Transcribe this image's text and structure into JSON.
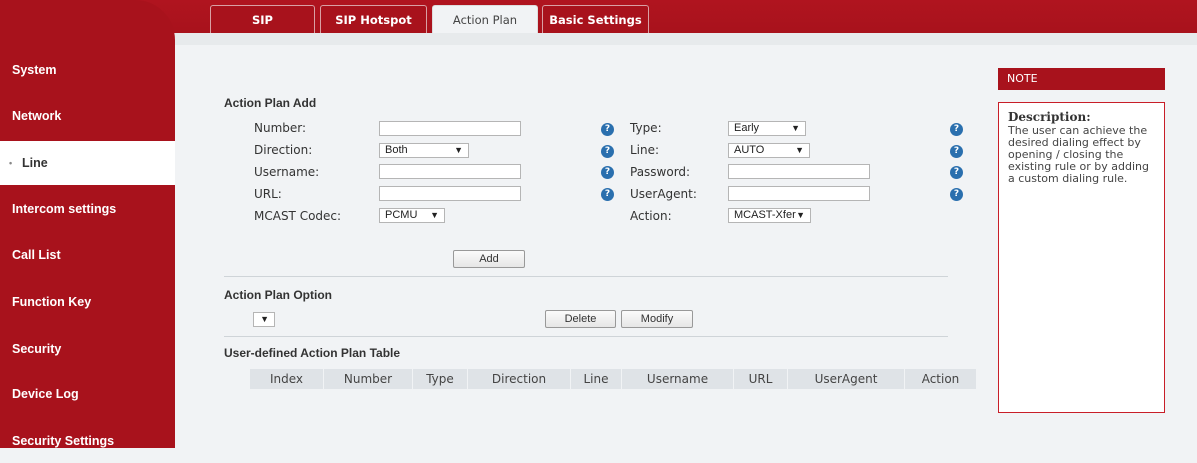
{
  "tabs": [
    {
      "label": "SIP",
      "active": false
    },
    {
      "label": "SIP Hotspot",
      "active": false
    },
    {
      "label": "Action Plan",
      "active": true
    },
    {
      "label": "Basic Settings",
      "active": false
    }
  ],
  "sidebar": {
    "items": [
      {
        "label": "System"
      },
      {
        "label": "Network"
      },
      {
        "label": "Line",
        "active": true
      },
      {
        "label": "Intercom settings"
      },
      {
        "label": "Call List"
      },
      {
        "label": "Function Key"
      },
      {
        "label": "Security"
      },
      {
        "label": "Device Log"
      },
      {
        "label": "Security Settings"
      }
    ]
  },
  "add_section": {
    "title": "Action Plan Add",
    "number_label": "Number:",
    "number_value": "",
    "direction_label": "Direction:",
    "direction_value": "Both",
    "username_label": "Username:",
    "username_value": "",
    "url_label": "URL:",
    "url_value": "",
    "mcast_codec_label": "MCAST Codec:",
    "mcast_codec_value": "PCMU",
    "type_label": "Type:",
    "type_value": "Early",
    "line_label": "Line:",
    "line_value": "AUTO",
    "password_label": "Password:",
    "password_value": "",
    "useragent_label": "UserAgent:",
    "useragent_value": "",
    "action_label": "Action:",
    "action_value": "MCAST-Xfer",
    "add_button": "Add",
    "help_glyph": "?"
  },
  "option_section": {
    "title": "Action Plan Option",
    "select_value": "",
    "delete_button": "Delete",
    "modify_button": "Modify"
  },
  "table": {
    "title": "User-defined Action Plan Table",
    "columns": [
      "Index",
      "Number",
      "Type",
      "Direction",
      "Line",
      "Username",
      "URL",
      "UserAgent",
      "Action"
    ]
  },
  "note": {
    "header": "NOTE",
    "title": "Description:",
    "text": "The user can achieve the desired dialing effect by opening / closing the existing rule or by adding a custom dialing rule."
  },
  "colors": {
    "brand": "#a8121c",
    "help": "#2a6fae"
  }
}
